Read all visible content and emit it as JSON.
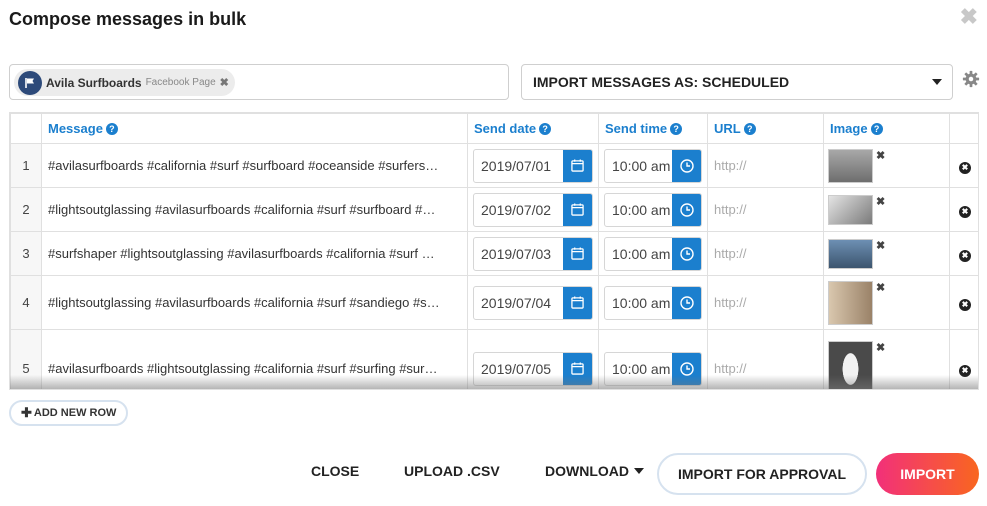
{
  "dialog": {
    "title": "Compose messages in bulk",
    "close_icon": "close-icon"
  },
  "profile": {
    "name": "Avila Surfboards",
    "type": "Facebook Page",
    "remove": "✖"
  },
  "import_select": {
    "value": "IMPORT MESSAGES AS: SCHEDULED"
  },
  "table": {
    "headers": {
      "message": "Message",
      "send_date": "Send date",
      "send_time": "Send time",
      "url": "URL",
      "image": "Image"
    },
    "rows": [
      {
        "num": "1",
        "message": "#avilasurfboards #california #surf #surfboard #oceanside #surfers…",
        "date": "2019/07/01",
        "time": "10:00 am",
        "url_placeholder": "http://",
        "thumb_color": "#9a9a9a"
      },
      {
        "num": "2",
        "message": "#lightsoutglassing #avilasurfboards #california #surf #surfboard #…",
        "date": "2019/07/02",
        "time": "10:00 am",
        "url_placeholder": "http://",
        "thumb_color": "#c8c8c8"
      },
      {
        "num": "3",
        "message": "#surfshaper #lightsoutglassing #avilasurfboards #california #surf …",
        "date": "2019/07/03",
        "time": "10:00 am",
        "url_placeholder": "http://",
        "thumb_color": "#4a6a8a"
      },
      {
        "num": "4",
        "message": "#lightsoutglassing #avilasurfboards #california #surf #sandiego #s…",
        "date": "2019/07/04",
        "time": "10:00 am",
        "url_placeholder": "http://",
        "thumb_color": "#b09a82"
      },
      {
        "num": "5",
        "message": "#avilasurfboards #lightsoutglassing #california #surf #surfing #sur…",
        "date": "2019/07/05",
        "time": "10:00 am",
        "url_placeholder": "http://",
        "thumb_color": "#555555"
      }
    ]
  },
  "add_row": {
    "label": "ADD NEW ROW"
  },
  "footer": {
    "close": "CLOSE",
    "upload": "UPLOAD .CSV",
    "download": "DOWNLOAD",
    "approval": "IMPORT FOR APPROVAL",
    "import": "IMPORT"
  },
  "colors": {
    "accent": "#1b7fce",
    "import_gradient_start": "#f2307a",
    "import_gradient_end": "#f9661f"
  }
}
